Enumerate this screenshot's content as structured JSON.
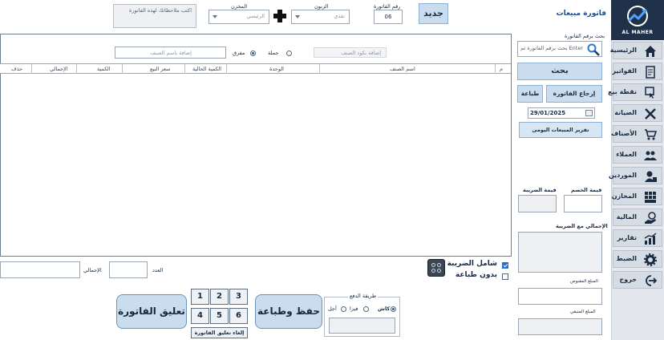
{
  "app": {
    "brand": "AL MAHER",
    "page_title": "فاتورة مبيعات"
  },
  "sidebar": {
    "items": [
      {
        "label": "الرئيسية",
        "icon": "home-icon"
      },
      {
        "label": "الفواتير",
        "icon": "invoice-icon"
      },
      {
        "label": "نقطة بيع",
        "icon": "pos-icon"
      },
      {
        "label": "الصيانة",
        "icon": "tools-icon"
      },
      {
        "label": "الأصناف",
        "icon": "cart-icon"
      },
      {
        "label": "العملاء",
        "icon": "customers-icon"
      },
      {
        "label": "الموردين",
        "icon": "supplier-icon"
      },
      {
        "label": "المخازن",
        "icon": "warehouse-icon"
      },
      {
        "label": "المالية",
        "icon": "finance-icon"
      },
      {
        "label": "تقارير",
        "icon": "reports-icon"
      },
      {
        "label": "الضبط",
        "icon": "gear-icon"
      },
      {
        "label": "خروج",
        "icon": "logout-icon"
      }
    ]
  },
  "header": {
    "new_button": "جديد",
    "invoice_no_label": "رقم الفاتورة",
    "invoice_no_value": "06",
    "customer_label": "الزبون",
    "customer_value": "نقدي",
    "warehouse_label": "المخزن",
    "warehouse_value": "الرئيسي",
    "notes_placeholder": "اكتب  ملاحظاتك لهذه الفاتورة"
  },
  "item_entry": {
    "barcode_placeholder": "إضافة بكود الصنف",
    "wholesale_label": "جملة",
    "retail_label": "مفرق",
    "selected_mode": "retail",
    "name_placeholder": "إضافة باسم الصنف"
  },
  "grid": {
    "columns": [
      "م",
      "اسم الصنف",
      "الوحدة",
      "الكمية الحالية",
      "سعر البيع",
      "الكمية",
      "الإجمالي",
      "حذف"
    ],
    "rows": []
  },
  "right_panel": {
    "search_label": "بحث برقم الفاتورة",
    "search_placeholder": "بحث برقم الفاتورة ثم Enter",
    "search_button": "بحث",
    "return_button": "إرجاع الفاتورة",
    "print_button": "طباعة",
    "date_value": "29/01/2025",
    "daily_report_button": "تقرير المبيعات اليومى",
    "discount_label": "قيمة الخصم",
    "tax_label": "قيمة الضريبة",
    "total_with_tax_label": "الإجمالي مع الضريبة",
    "received_label": "المبلغ المقبوض",
    "remaining_label": "المبلغ المتبقي"
  },
  "footer": {
    "include_tax_label": "شامل الضريبة",
    "include_tax_checked": true,
    "no_print_label": "بدون طباعة",
    "no_print_checked": false,
    "count_label": "العدد",
    "total_label": "الإجمالي",
    "payment_method_label": "طريقة الدفع",
    "payment_options": [
      "كاش",
      "فيزا",
      "آجل"
    ],
    "payment_selected": "كاش",
    "save_print_button": "حفظ وطباعة F2",
    "hold_invoice_button": "تعليق الفاتورة F6",
    "held_keys": [
      "1",
      "2",
      "3",
      "4",
      "5",
      "6"
    ],
    "cancel_hold_button": "إلغاء تعليق الفاتورة"
  },
  "colors": {
    "sidebar_bg": "#e4e8ee",
    "logo_bg": "#20324a",
    "accent_button": "#c9ddef",
    "radio_selected": "#1c5fa8"
  }
}
